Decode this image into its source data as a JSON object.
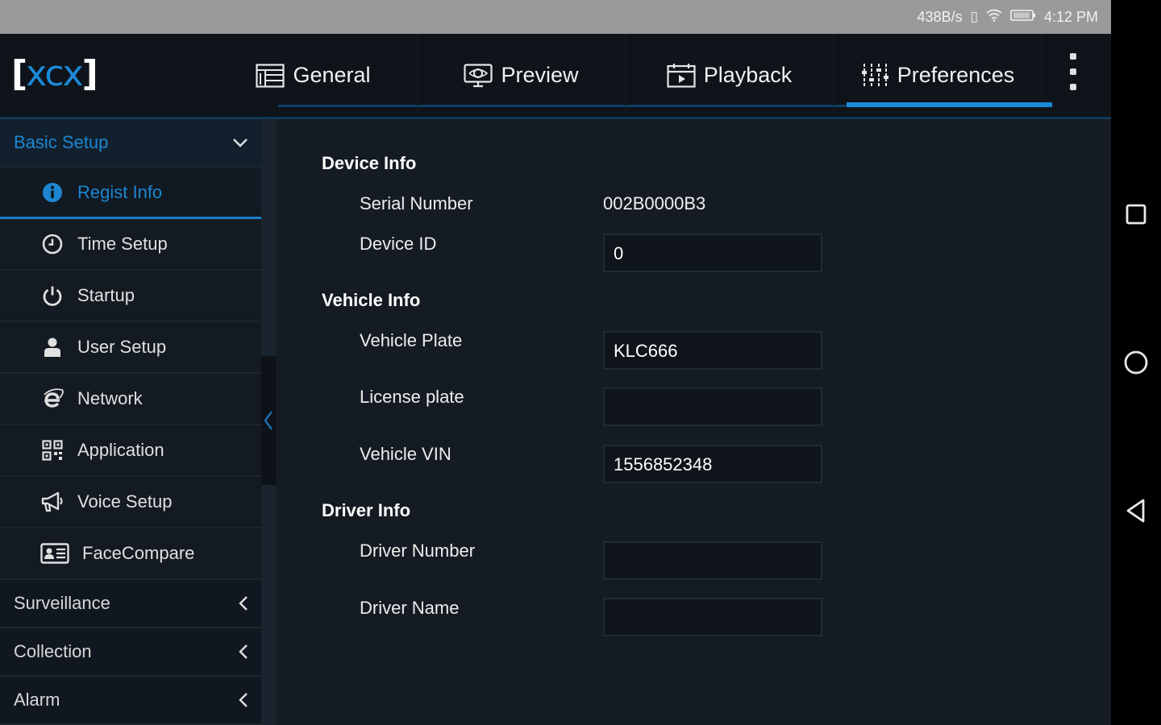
{
  "status_bar": {
    "speed": "438B/s",
    "time": "4:12 PM"
  },
  "app": {
    "logo_bracket_left": "[",
    "logo_text": "xcx",
    "logo_bracket_right": "]"
  },
  "tabs": [
    {
      "label": "General",
      "icon": "grid-icon"
    },
    {
      "label": "Preview",
      "icon": "monitor-icon"
    },
    {
      "label": "Playback",
      "icon": "calendar-icon"
    },
    {
      "label": "Preferences",
      "icon": "sliders-icon",
      "active": true
    }
  ],
  "sidebar": {
    "basic_setup": "Basic Setup",
    "items": [
      {
        "label": "Regist Info",
        "icon": "info-icon",
        "active": true
      },
      {
        "label": "Time Setup",
        "icon": "clock-icon"
      },
      {
        "label": "Startup",
        "icon": "power-icon"
      },
      {
        "label": "User Setup",
        "icon": "user-icon"
      },
      {
        "label": "Network",
        "icon": "network-icon"
      },
      {
        "label": "Application",
        "icon": "qr-icon"
      },
      {
        "label": "Voice Setup",
        "icon": "megaphone-icon"
      },
      {
        "label": "FaceCompare",
        "icon": "id-card-icon"
      }
    ],
    "surveillance": "Surveillance",
    "collection": "Collection",
    "alarm": "Alarm"
  },
  "form": {
    "device_info": "Device Info",
    "serial_number_label": "Serial Number",
    "serial_number_value": "002B0000B3",
    "device_id_label": "Device ID",
    "device_id_value": "0",
    "vehicle_info": "Vehicle Info",
    "vehicle_plate_label": "Vehicle Plate",
    "vehicle_plate_value": "KLC666",
    "license_plate_label": "License plate",
    "license_plate_value": "",
    "vehicle_vin_label": "Vehicle VIN",
    "vehicle_vin_value": "1556852348",
    "driver_info": "Driver Info",
    "driver_number_label": "Driver Number",
    "driver_number_value": "",
    "driver_name_label": "Driver Name",
    "driver_name_value": ""
  },
  "colors": {
    "accent": "#1a8bd8",
    "background": "#151b22",
    "sidebar": "#0d1218"
  }
}
